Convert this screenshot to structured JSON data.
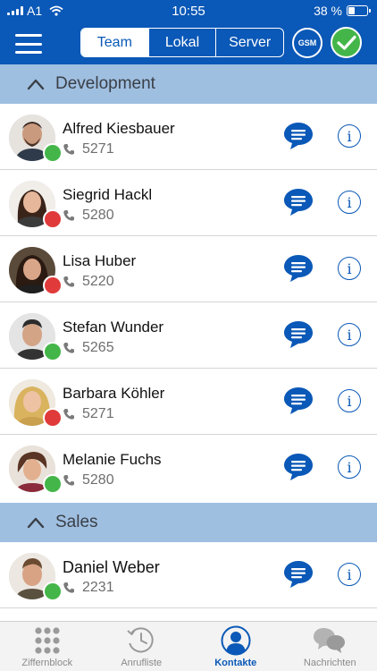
{
  "status_bar": {
    "carrier": "A1",
    "time": "10:55",
    "battery_text": "38 %",
    "battery_level": 0.38
  },
  "nav": {
    "segments": [
      {
        "label": "Team",
        "active": true
      },
      {
        "label": "Lokal",
        "active": false
      },
      {
        "label": "Server",
        "active": false
      }
    ],
    "gsm_label": "GSM"
  },
  "sections": [
    {
      "title": "Development",
      "contacts": [
        {
          "name": "Alfred Kiesbauer",
          "extension": "5271",
          "status": "online"
        },
        {
          "name": "Siegrid Hackl",
          "extension": "5280",
          "status": "busy"
        },
        {
          "name": "Lisa Huber",
          "extension": "5220",
          "status": "busy"
        },
        {
          "name": "Stefan Wunder",
          "extension": "5265",
          "status": "online"
        },
        {
          "name": "Barbara Köhler",
          "extension": "5271",
          "status": "busy"
        },
        {
          "name": "Melanie Fuchs",
          "extension": "5280",
          "status": "online"
        }
      ]
    },
    {
      "title": "Sales",
      "contacts": [
        {
          "name": "Daniel Weber",
          "extension": "2231",
          "status": "online"
        }
      ]
    }
  ],
  "tabs": [
    {
      "label": "Ziffernblock",
      "icon": "keypad-icon",
      "active": false
    },
    {
      "label": "Anrufliste",
      "icon": "history-icon",
      "active": false
    },
    {
      "label": "Kontakte",
      "icon": "contact-icon",
      "active": true
    },
    {
      "label": "Nachrichten",
      "icon": "messages-icon",
      "active": false
    }
  ],
  "colors": {
    "primary": "#0a58b7",
    "section_bg": "#9fbfe1",
    "online": "#44b649",
    "busy": "#e03a3a"
  }
}
